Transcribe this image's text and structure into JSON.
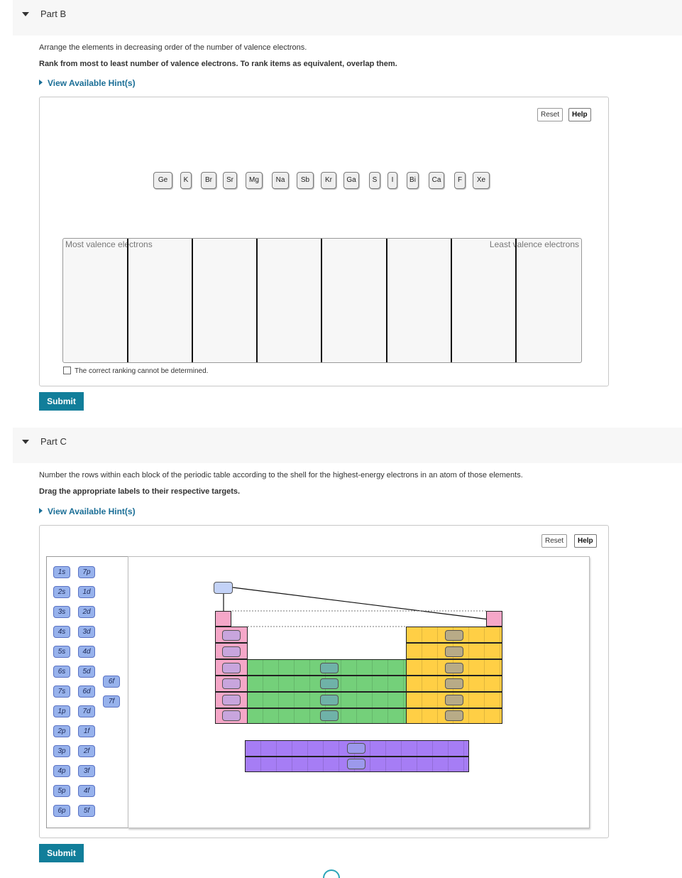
{
  "partB": {
    "title": "Part B",
    "instruction": "Arrange the elements in decreasing order of the number of valence electrons.",
    "instruction_bold": "Rank from most to least number of valence electrons. To rank items as equivalent, overlap them.",
    "hint_label": "View Available Hint(s)",
    "reset_label": "Reset",
    "help_label": "Help",
    "elements": [
      "Ge",
      "K",
      "Br",
      "Sr",
      "Mg",
      "Na",
      "Sb",
      "Kr",
      "Ga",
      "S",
      "I",
      "Bi",
      "Ca",
      "F",
      "Xe"
    ],
    "most_label": "Most valence electrons",
    "least_label": "Least valence electrons",
    "checkbox_label": "The correct ranking cannot be determined.",
    "submit_label": "Submit"
  },
  "partC": {
    "title": "Part C",
    "instruction": "Number the rows within each block of the periodic table according to the shell for the highest-energy electrons in an atom of those elements.",
    "instruction_bold": "Drag the appropriate labels to their respective targets.",
    "hint_label": "View Available Hint(s)",
    "reset_label": "Reset",
    "help_label": "Help",
    "labels_col1": [
      "1s",
      "2s",
      "3s",
      "4s",
      "5s",
      "6s",
      "7s",
      "1p",
      "2p",
      "3p",
      "4p",
      "5p",
      "6p"
    ],
    "labels_col2": [
      "7p",
      "1d",
      "2d",
      "3d",
      "4d",
      "5d",
      "6d",
      "7d",
      "1f",
      "2f",
      "3f",
      "4f",
      "5f"
    ],
    "labels_col3": [
      "6f",
      "7f"
    ],
    "submit_label": "Submit",
    "colors": {
      "s_block": "#f5a7c8",
      "d_block": "#74d07a",
      "p_block": "#ffcf45",
      "f_block": "#a67df5",
      "label": "#97b2ec"
    }
  }
}
